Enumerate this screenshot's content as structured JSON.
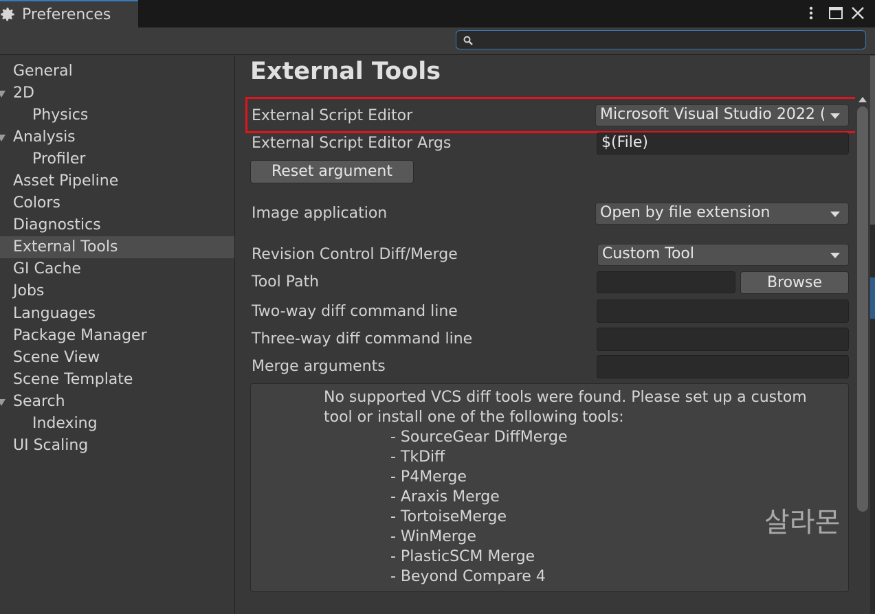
{
  "window": {
    "tab_title": "Preferences",
    "icons": {
      "tab": "gear-icon",
      "menu": "kebab-menu-icon",
      "maximize": "maximize-icon",
      "close": "close-icon"
    }
  },
  "search": {
    "value": "",
    "icon": "search-icon"
  },
  "sidebar": {
    "items": [
      {
        "label": "General",
        "indent": 0,
        "foldout": false,
        "selected": false
      },
      {
        "label": "2D",
        "indent": 0,
        "foldout": true,
        "selected": false
      },
      {
        "label": "Physics",
        "indent": 1,
        "foldout": false,
        "selected": false
      },
      {
        "label": "Analysis",
        "indent": 0,
        "foldout": true,
        "selected": false
      },
      {
        "label": "Profiler",
        "indent": 1,
        "foldout": false,
        "selected": false
      },
      {
        "label": "Asset Pipeline",
        "indent": 0,
        "foldout": false,
        "selected": false
      },
      {
        "label": "Colors",
        "indent": 0,
        "foldout": false,
        "selected": false
      },
      {
        "label": "Diagnostics",
        "indent": 0,
        "foldout": false,
        "selected": false
      },
      {
        "label": "External Tools",
        "indent": 0,
        "foldout": false,
        "selected": true
      },
      {
        "label": "GI Cache",
        "indent": 0,
        "foldout": false,
        "selected": false
      },
      {
        "label": "Jobs",
        "indent": 0,
        "foldout": false,
        "selected": false
      },
      {
        "label": "Languages",
        "indent": 0,
        "foldout": false,
        "selected": false
      },
      {
        "label": "Package Manager",
        "indent": 0,
        "foldout": false,
        "selected": false
      },
      {
        "label": "Scene View",
        "indent": 0,
        "foldout": false,
        "selected": false
      },
      {
        "label": "Scene Template",
        "indent": 0,
        "foldout": false,
        "selected": false
      },
      {
        "label": "Search",
        "indent": 0,
        "foldout": true,
        "selected": false
      },
      {
        "label": "Indexing",
        "indent": 1,
        "foldout": false,
        "selected": false
      },
      {
        "label": "UI Scaling",
        "indent": 0,
        "foldout": false,
        "selected": false
      }
    ]
  },
  "main": {
    "title": "External Tools",
    "external_script_editor": {
      "label": "External Script Editor",
      "value": "Microsoft Visual Studio 2022 ("
    },
    "external_script_editor_args": {
      "label": "External Script Editor Args",
      "value": "$(File)"
    },
    "reset_argument_label": "Reset argument",
    "image_application": {
      "label": "Image application",
      "value": "Open by file extension"
    },
    "revision_control": {
      "label": "Revision Control Diff/Merge",
      "value": "Custom Tool"
    },
    "tool_path": {
      "label": "Tool Path",
      "value": "",
      "browse_label": "Browse"
    },
    "two_way": {
      "label": "Two-way diff command line",
      "value": ""
    },
    "three_way": {
      "label": "Three-way diff command line",
      "value": ""
    },
    "merge_args": {
      "label": "Merge arguments",
      "value": ""
    },
    "help": {
      "line1": "No supported VCS diff tools were found. Please set up a custom",
      "line2": "tool or install one of the following tools:",
      "tools": [
        "- SourceGear DiffMerge",
        "- TkDiff",
        "- P4Merge",
        "- Araxis Merge",
        "- TortoiseMerge",
        "- WinMerge",
        "- PlasticSCM Merge",
        "- Beyond Compare 4"
      ]
    }
  },
  "watermark": "살라몬",
  "colors": {
    "accent": "#3a79bb",
    "highlight_box": "#e0141c",
    "selected_row": "#4d4d4d"
  }
}
